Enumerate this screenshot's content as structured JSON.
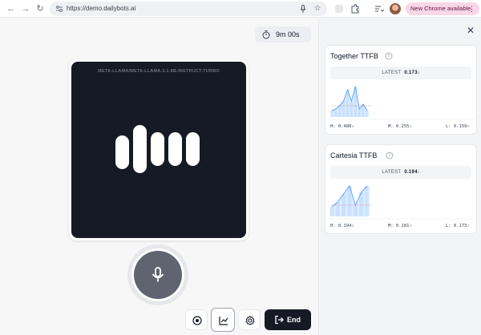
{
  "browser": {
    "url": "https://demo.dailybots.ai",
    "update_label": "New Chrome available"
  },
  "session": {
    "timer": "9m 00s",
    "model": "META-LLAMA/META-LLAMA-3.1-8B-INSTRUCT-TURBO",
    "end_label": "End"
  },
  "metrics": [
    {
      "title": "Together TTFB",
      "latest_label": "LATEST",
      "latest_value": "0.173",
      "latest_unit": "s",
      "high_label": "H:",
      "high": "0.480",
      "mid_label": "M:",
      "mid": "0.255",
      "low_label": "L:",
      "low": "0.159",
      "unit": "s",
      "spark": [
        0.2,
        0.25,
        0.35,
        0.5,
        0.85,
        0.5,
        0.95,
        0.25,
        0.4,
        0.2
      ]
    },
    {
      "title": "Cartesia TTFB",
      "latest_label": "LATEST",
      "latest_value": "0.194",
      "latest_unit": "s",
      "high_label": "H:",
      "high": "0.194",
      "mid_label": "M:",
      "mid": "0.181",
      "low_label": "L:",
      "low": "0.173",
      "unit": "s",
      "spark": [
        0.3,
        0.45,
        0.7,
        0.95,
        0.35,
        0.75,
        0.95
      ]
    }
  ],
  "colors": {
    "accent": "#151a24",
    "spark_line": "#60a5fa",
    "spark_fill": "#bfdbfe",
    "pill": "#f8d7e6"
  }
}
